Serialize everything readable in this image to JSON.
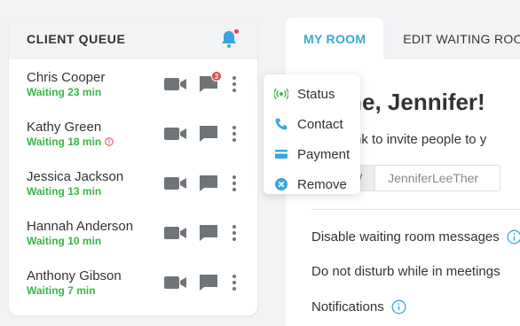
{
  "queue": {
    "title": "CLIENT QUEUE",
    "clients": [
      {
        "name": "Chris Cooper",
        "wait": "Waiting 23 min",
        "unread": "3",
        "warning": false
      },
      {
        "name": "Kathy Green",
        "wait": "Waiting 18 min",
        "unread": null,
        "warning": true
      },
      {
        "name": "Jessica Jackson",
        "wait": "Waiting 13 min",
        "unread": null,
        "warning": false
      },
      {
        "name": "Hannah Anderson",
        "wait": "Waiting 10 min",
        "unread": null,
        "warning": false
      },
      {
        "name": "Anthony Gibson",
        "wait": "Waiting 7 min",
        "unread": null,
        "warning": false
      }
    ]
  },
  "menu": {
    "items": [
      {
        "label": "Status",
        "icon": "broadcast-icon"
      },
      {
        "label": "Contact",
        "icon": "phone-icon"
      },
      {
        "label": "Payment",
        "icon": "credit-card-icon"
      },
      {
        "label": "Remove",
        "icon": "remove-icon"
      }
    ]
  },
  "tabs": {
    "my_room": "MY ROOM",
    "edit_waiting_room": "EDIT WAITING ROO"
  },
  "room": {
    "welcome": "ome, Jennifer!",
    "invite_text": "his link to invite people to y",
    "link_prefix": "ink.net/",
    "link_value": "JenniferLeeTher",
    "settings": [
      "Disable waiting room messages",
      "Do not disturb while in meetings",
      "Notifications"
    ]
  },
  "colors": {
    "accent": "#3aa7da",
    "waiting_green": "#3cb449",
    "alert_red": "#e8414e",
    "icon_gray": "#6f7478",
    "status_green": "#3cb449"
  }
}
